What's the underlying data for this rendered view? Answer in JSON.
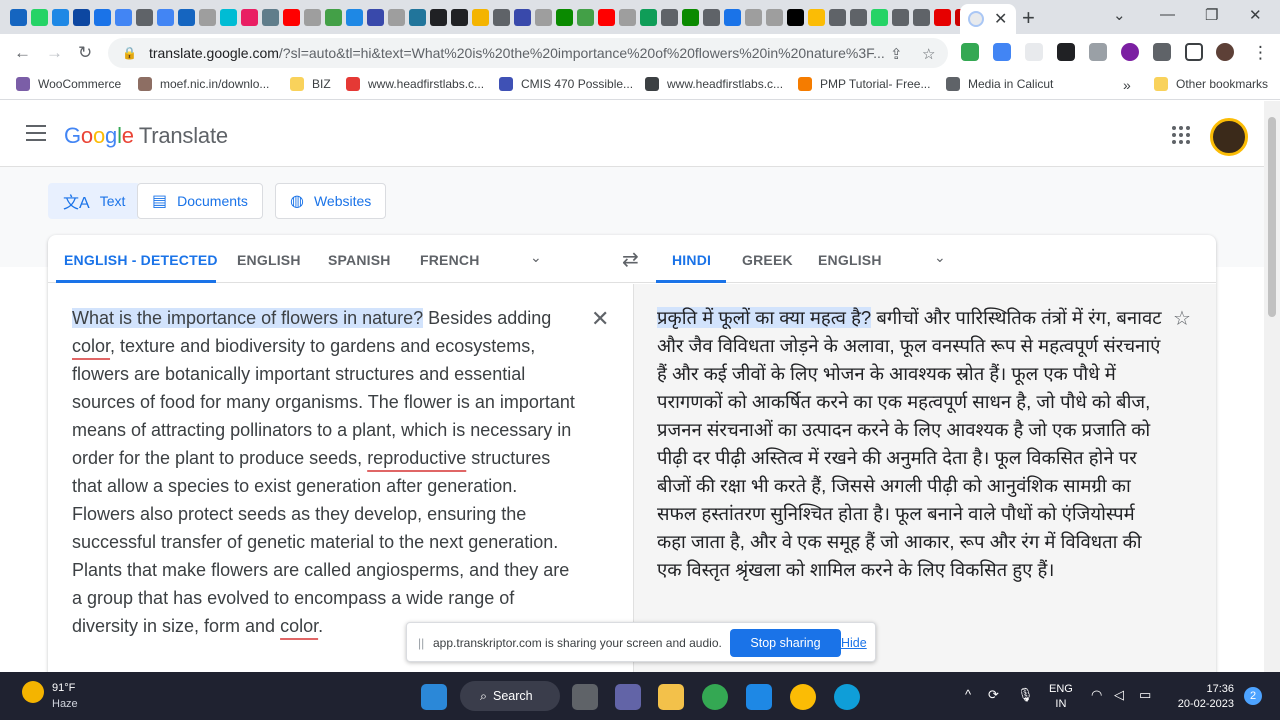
{
  "browser": {
    "active_tab_close": "✕",
    "new_tab": "+",
    "url_host": "translate.google.com",
    "url_path": "/?sl=auto&tl=hi&text=What%20is%20the%20importance%20of%20flowers%20in%20nature%3F...",
    "bookmarks": [
      {
        "label": "WooCommerce",
        "color": "#7b5ea7"
      },
      {
        "label": "moef.nic.in/downlo...",
        "color": "#8d6e63"
      },
      {
        "label": "BIZ",
        "color": "#f9d25b"
      },
      {
        "label": "www.headfirstlabs.c...",
        "color": "#e53935"
      },
      {
        "label": "CMIS 470 Possible...",
        "color": "#3f51b5"
      },
      {
        "label": "www.headfirstlabs.c...",
        "color": "#3c4043"
      },
      {
        "label": "PMP Tutorial- Free...",
        "color": "#f57c00"
      },
      {
        "label": "Media in Calicut",
        "color": "#5f6368"
      }
    ],
    "bookmarks_overflow": "»",
    "other_bookmarks": "Other bookmarks"
  },
  "header": {
    "logo": [
      "G",
      "o",
      "o",
      "g",
      "l",
      "e"
    ],
    "product": "Translate"
  },
  "modes": {
    "text": "Text",
    "documents": "Documents",
    "websites": "Websites"
  },
  "source_langs": [
    "ENGLISH - DETECTED",
    "ENGLISH",
    "SPANISH",
    "FRENCH"
  ],
  "target_langs": [
    "HINDI",
    "GREEK",
    "ENGLISH"
  ],
  "source_text": {
    "highlighted": "What is the importance of flowers in nature?",
    "p1": " Besides adding ",
    "w_color1": "color",
    "p2": ", texture and biodiversity to gardens and ecosystems, flowers are botanically important structures and essential sources of food for many organisms. The flower is an important means of attracting pollinators to a plant, which is necessary in order for the plant to produce seeds, ",
    "w_reproductive": "reproductive",
    "p3": " structures that allow a species to exist generation after generation. Flowers also protect seeds as they develop, ensuring the successful transfer of genetic material to the next generation. Plants that make flowers are called angiosperms, and they are a group that has evolved to encompass a wide range of diversity in size, form and ",
    "w_color2": "color",
    "p4": "."
  },
  "target_text": {
    "highlighted": "प्रकृति में फूलों का क्या महत्व है?",
    "rest": " बगीचों और पारिस्थितिक तंत्रों में रंग, बनावट और जैव विविधता जोड़ने के अलावा, फूल वनस्पति रूप से महत्वपूर्ण संरचनाएं हैं और कई जीवों के लिए भोजन के आवश्यक स्रोत हैं। फूल एक पौधे में परागणकों को आकर्षित करने का एक महत्वपूर्ण साधन है, जो पौधे को बीज, प्रजनन संरचनाओं का उत्पादन करने के लिए आवश्यक है जो एक प्रजाति को पीढ़ी दर पीढ़ी अस्तित्व में रखने की अनुमति देता है। फूल विकसित होने पर बीजों की रक्षा भी करते हैं, जिससे अगली पीढ़ी को आनुवंशिक सामग्री का सफल हस्तांतरण सुनिश्चित होता है। फूल बनाने वाले पौधों को एंजियोस्पर्म कहा जाता है, और वे एक समूह हैं जो आकार, रूप और रंग में विविधता की एक विस्तृत श्रृंखला को शामिल करने के लिए विकसित हुए हैं।"
  },
  "share_bar": {
    "message": "app.transkriptor.com is sharing your screen and audio.",
    "stop": "Stop sharing",
    "hide": "Hide"
  },
  "taskbar": {
    "temp": "91°F",
    "weather": "Haze",
    "search": "Search",
    "lang_line1": "ENG",
    "lang_line2": "IN",
    "time": "17:36",
    "date": "20-02-2023",
    "notifications": "2"
  }
}
